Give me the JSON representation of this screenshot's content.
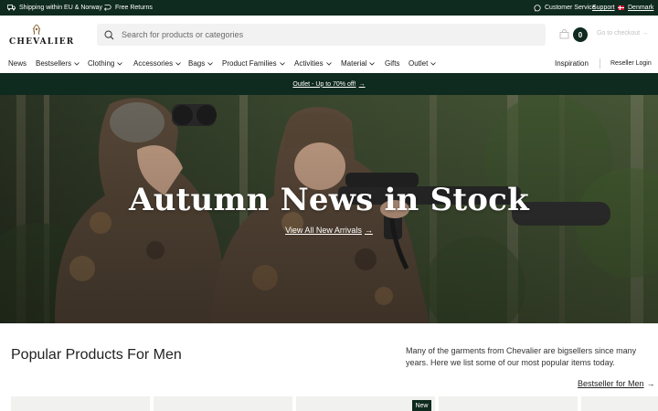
{
  "topbar": {
    "shipping": "Shipping within EU & Norway",
    "returns": "Free Returns",
    "customer_service": "Customer Service",
    "support": "Support",
    "country": "Denmark",
    "icons": [
      "truck-icon",
      "returns-icon",
      "chat-icon",
      "denmark-flag-icon"
    ]
  },
  "header": {
    "logo_text": "CHEVALIER",
    "search_placeholder": "Search for products or categories",
    "cart_count": "0",
    "checkout_label": "Go to checkout",
    "icons": [
      "search-icon",
      "bag-icon",
      "arrow-right-icon"
    ]
  },
  "nav": {
    "items": [
      {
        "label": "News",
        "dropdown": false
      },
      {
        "label": "Bestsellers",
        "dropdown": true
      },
      {
        "label": "Clothing",
        "dropdown": true
      },
      {
        "label": "Accessories",
        "dropdown": true
      },
      {
        "label": "Bags",
        "dropdown": true
      },
      {
        "label": "Product Families",
        "dropdown": true
      },
      {
        "label": "Activities",
        "dropdown": true
      },
      {
        "label": "Material",
        "dropdown": true
      },
      {
        "label": "Gifts",
        "dropdown": false
      },
      {
        "label": "Outlet",
        "dropdown": true
      }
    ],
    "inspiration": "Inspiration",
    "reseller_login": "Reseller Login"
  },
  "promo": {
    "text": "Outlet - Up to 70% off!"
  },
  "hero": {
    "title": "Autumn News in Stock",
    "cta": "View All New Arrivals"
  },
  "popular": {
    "title": "Popular Products For Men",
    "description": "Many of the garments from Chevalier are bigsellers since many years. Here we list some of our most popular items today.",
    "link": "Bestseller for Men",
    "badge": "New"
  },
  "colors": {
    "brand_dark_green": "#0f2a1f",
    "card_bg": "#f1f1ef",
    "search_bg": "#f2f2f2"
  }
}
